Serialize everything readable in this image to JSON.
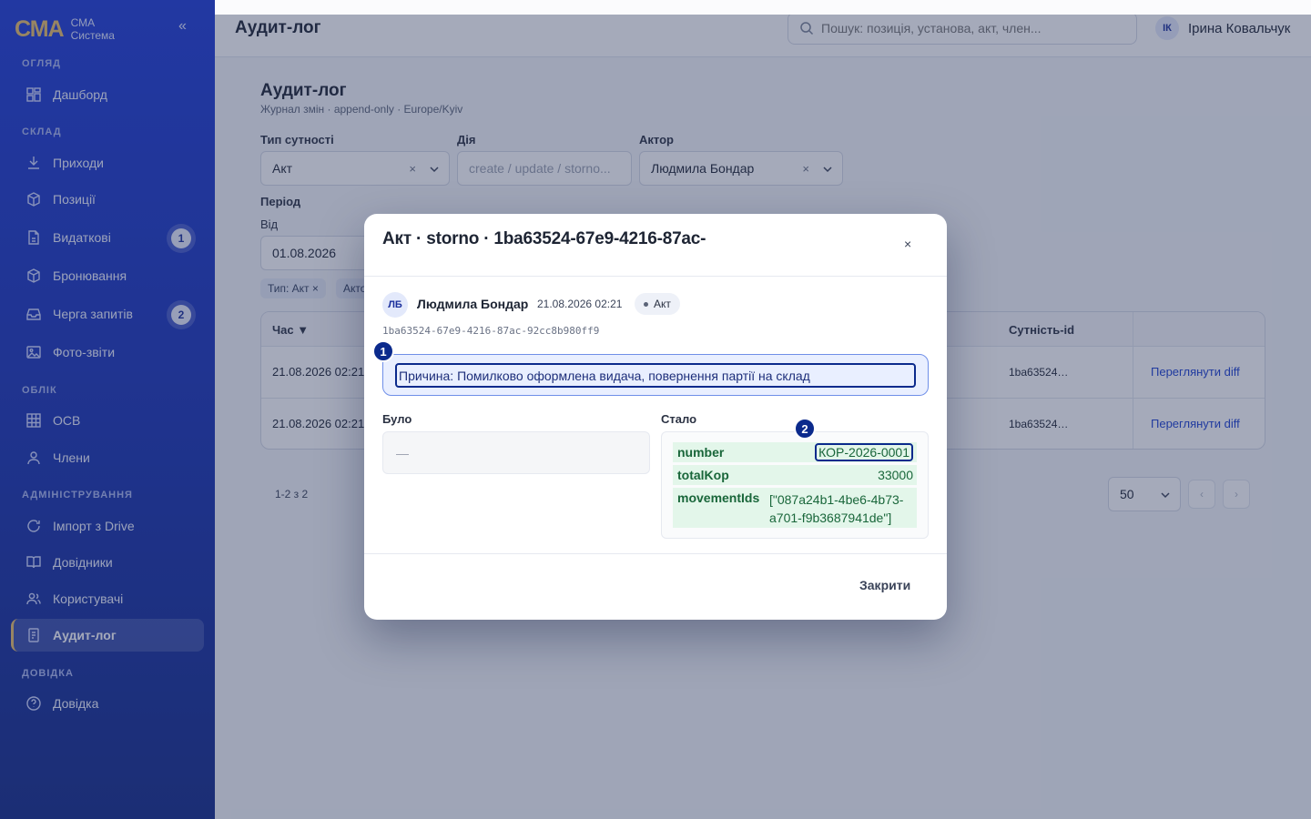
{
  "sidebar": {
    "brand_logo": "СМА",
    "brand_line1": "СМА",
    "brand_line2": "Система",
    "collapse": "«",
    "sections": {
      "overview": "ОГЛЯД",
      "stock": "СКЛАД",
      "accounting": "ОБЛІК",
      "admin": "АДМІНІСТРУВАННЯ",
      "help": "ДОВІДКА"
    },
    "items": {
      "dashboard": "Дашборд",
      "receipts": "Приходи",
      "positions": "Позиції",
      "expenses": "Видаткові",
      "expenses_badge": "1",
      "booking": "Бронювання",
      "queue": "Черга запитів",
      "queue_badge": "2",
      "photo": "Фото-звіти",
      "osv": "ОСВ",
      "members": "Члени",
      "import": "Імпорт з Drive",
      "directories": "Довідники",
      "users": "Користувачі",
      "audit": "Аудит-лог",
      "help": "Довідка"
    }
  },
  "topbar": {
    "title": "Аудит-лог",
    "search_placeholder": "Пошук: позиція, установа, акт, член...",
    "user_initials": "ІК",
    "user_name": "Ірина Ковальчук"
  },
  "page": {
    "title": "Аудит-лог",
    "subtitle": "Журнал змін · append-only · Europe/Kyiv",
    "filters": {
      "entity_label": "Тип сутності",
      "entity_value": "Акт",
      "action_label": "Дія",
      "action_placeholder": "create / update / storno...",
      "actor_label": "Актор",
      "actor_value": "Людмила Бондар",
      "period_label": "Період",
      "from_label": "Від",
      "from_value": "01.08.2026",
      "clear": "×"
    },
    "chips": [
      "Тип: Акт ×",
      "Акто"
    ],
    "table": {
      "col_time": "Час ▼",
      "col_entity_id": "Сутність-id",
      "rows": [
        {
          "time": "21.08.2026 02:21",
          "entity_id": "1ba63524…",
          "action": "Переглянути diff"
        },
        {
          "time": "21.08.2026 02:21",
          "entity_id": "1ba63524…",
          "action": "Переглянути diff"
        }
      ]
    },
    "pagination": {
      "info": "1-2 з 2",
      "per_page": "50",
      "prev": "‹",
      "next": "›"
    }
  },
  "modal": {
    "title": "Акт · storno · 1ba63524-67e9-4216-87ac-",
    "close": "×",
    "actor_initials": "ЛБ",
    "actor": "Людмила Бондар",
    "date": "21.08.2026 02:21",
    "entity_type": "Акт",
    "full_id": "1ba63524-67e9-4216-87ac-92cc8b980ff9",
    "reason": "Причина: Помилково оформлена видача, повернення партії на склад",
    "was_label": "Було",
    "was_value": "—",
    "now_label": "Стало",
    "now_fields": [
      {
        "key": "number",
        "value": "КОР-2026-0001"
      },
      {
        "key": "totalKop",
        "value": "33000"
      },
      {
        "key": "movementIds",
        "value_line1": "[\"087a24b1-4be6-4b73-",
        "value_line2": "a701-f9b3687941de\"]"
      }
    ],
    "close_button": "Закрити",
    "markers": [
      "1",
      "2"
    ]
  }
}
